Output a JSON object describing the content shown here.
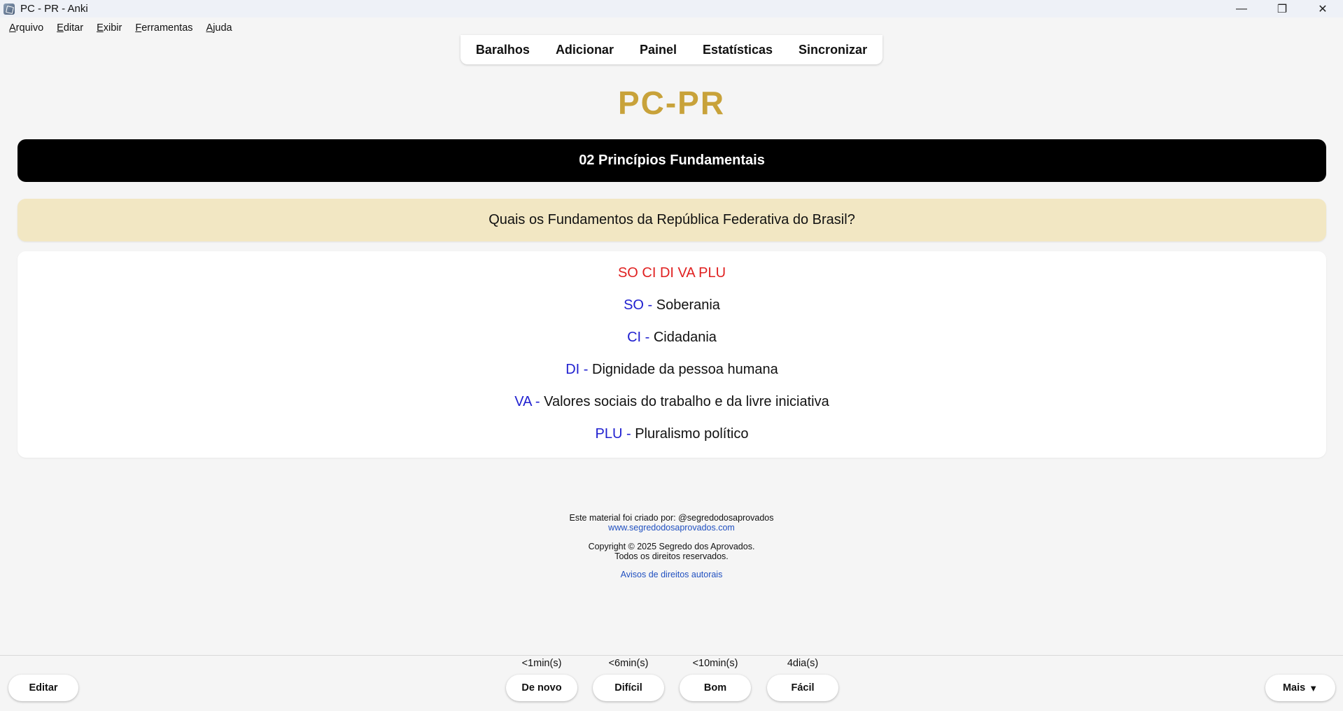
{
  "window": {
    "title": "PC - PR - Anki",
    "controls": {
      "minimize": "—",
      "restore": "❐",
      "close": "✕"
    }
  },
  "menu": [
    {
      "key": "A",
      "rest": "rquivo"
    },
    {
      "key": "E",
      "rest": "ditar"
    },
    {
      "key": "E",
      "rest": "xibir"
    },
    {
      "key": "F",
      "rest": "erramentas"
    },
    {
      "key": "A",
      "rest": "juda"
    }
  ],
  "nav": {
    "decks": "Baralhos",
    "add": "Adicionar",
    "browse": "Painel",
    "stats": "Estatísticas",
    "sync": "Sincronizar"
  },
  "card": {
    "deck_title": "PC-PR",
    "topic": "02 Princípios Fundamentais",
    "question": "Quais os Fundamentos da República Federativa do Brasil?",
    "mnemonic": "SO CI DI VA PLU",
    "answers": [
      {
        "abbr": "SO -",
        "text": " Soberania"
      },
      {
        "abbr": "CI -",
        "text": " Cidadania"
      },
      {
        "abbr": "DI -",
        "text": " Dignidade da pessoa humana"
      },
      {
        "abbr": "VA -",
        "text": " Valores sociais do trabalho e da livre iniciativa"
      },
      {
        "abbr": "PLU -",
        "text": " Pluralismo político"
      }
    ]
  },
  "footer": {
    "credit": "Este material foi criado por: @segredodosaprovados",
    "website": "www.segredodosaprovados.com",
    "copyright": "Copyright © 2025 Segredo dos Aprovados.",
    "rights": "Todos os direitos reservados.",
    "notices": "Avisos de direitos autorais"
  },
  "review": {
    "edit": "Editar",
    "more": "Mais",
    "more_caret": "▼",
    "answers": [
      {
        "label": "De novo",
        "interval": "<1min(s)"
      },
      {
        "label": "Difícil",
        "interval": "<6min(s)"
      },
      {
        "label": "Bom",
        "interval": "<10min(s)"
      },
      {
        "label": "Fácil",
        "interval": "4dia(s)"
      }
    ]
  },
  "colors": {
    "deck_title": "#c8a23a",
    "topic_bg": "#000000",
    "question_bg": "#f2e7c3",
    "mnemonic": "#e02020",
    "abbr": "#2020d0",
    "link": "#2050c0"
  }
}
